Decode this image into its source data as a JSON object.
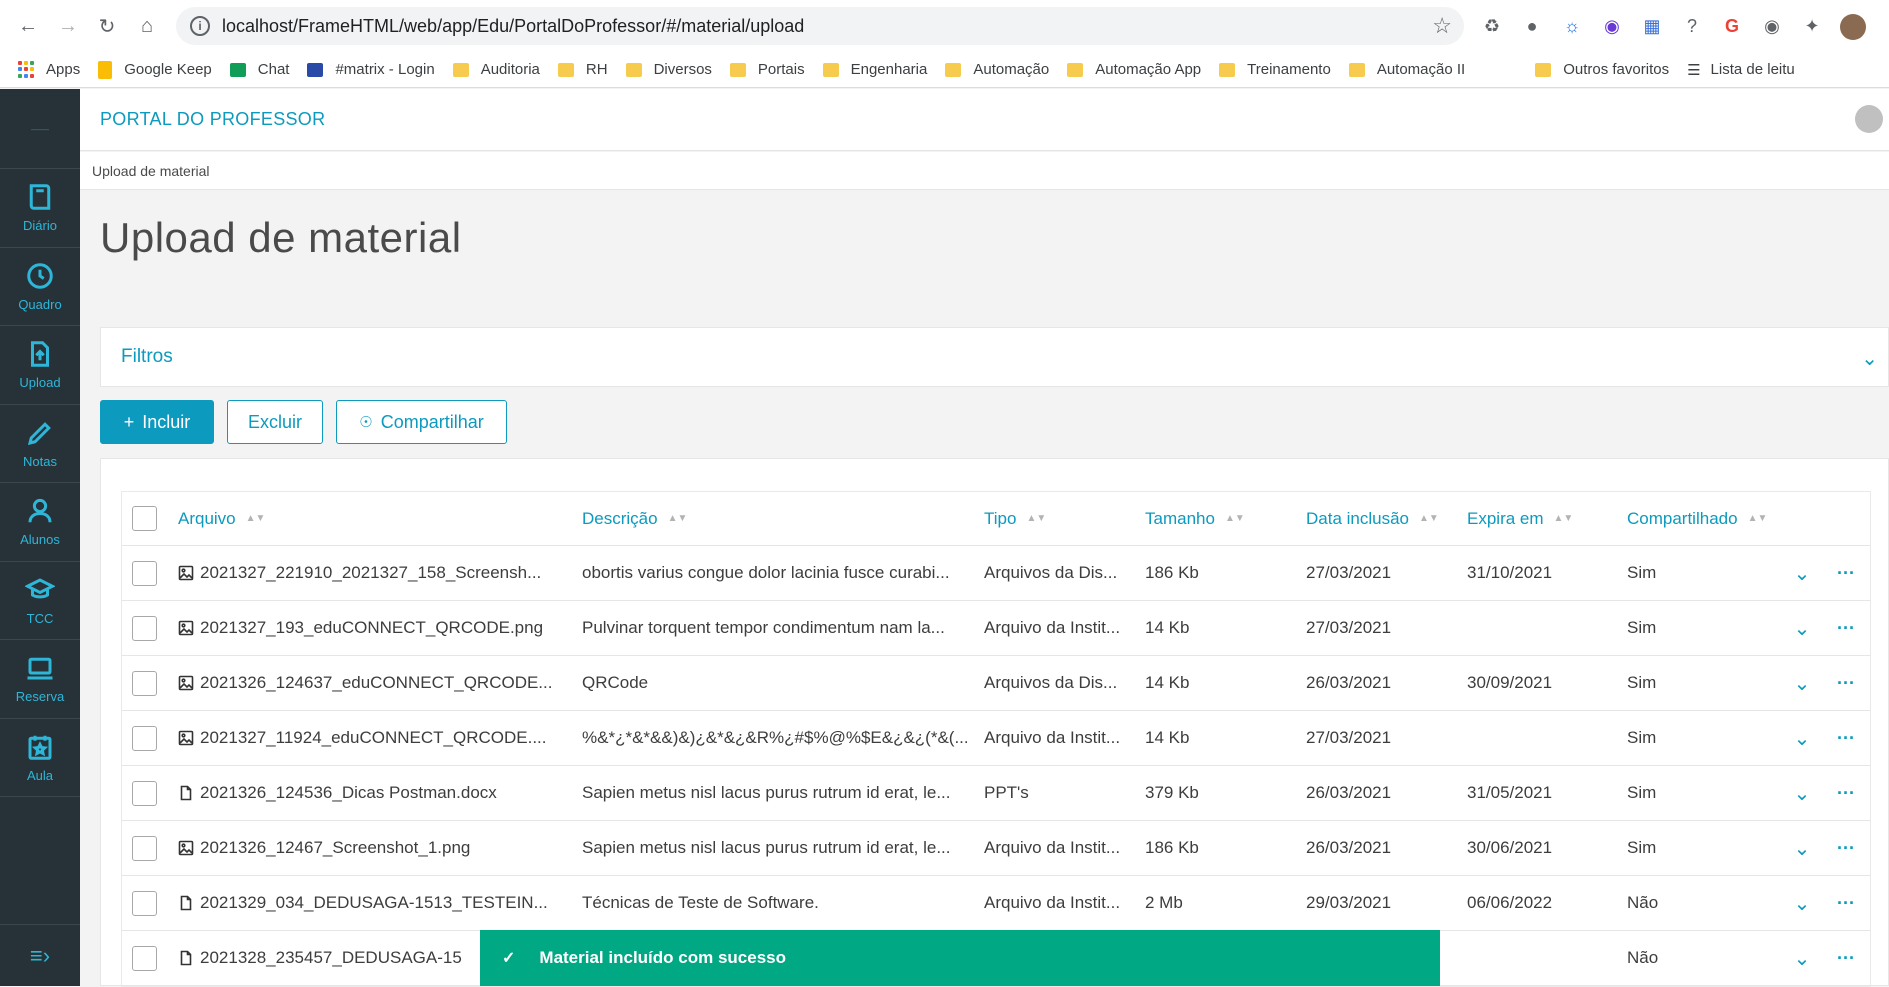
{
  "browser": {
    "url": "localhost/FrameHTML/web/app/Edu/PortalDoProfessor/#/material/upload",
    "bookmarks": [
      "Apps",
      "Google Keep",
      "Chat",
      "#matrix - Login",
      "Auditoria",
      "RH",
      "Diversos",
      "Portais",
      "Engenharia",
      "Automação",
      "Automação App",
      "Treinamento",
      "Automação II",
      "Outros favoritos",
      "Lista de leitu"
    ]
  },
  "sidebar": {
    "items": [
      {
        "label": "Diário",
        "icon": "book-icon"
      },
      {
        "label": "Quadro",
        "icon": "clock-icon"
      },
      {
        "label": "Upload",
        "icon": "upload-icon"
      },
      {
        "label": "Notas",
        "icon": "pencil-icon"
      },
      {
        "label": "Alunos",
        "icon": "user-icon"
      },
      {
        "label": "TCC",
        "icon": "graduation-cap-icon"
      },
      {
        "label": "Reserva",
        "icon": "laptop-icon"
      },
      {
        "label": "Aula",
        "icon": "calendar-star-icon"
      }
    ]
  },
  "header": {
    "title": "PORTAL DO PROFESSOR"
  },
  "breadcrumb": "Upload de material",
  "page": {
    "title": "Upload de material"
  },
  "filters": {
    "label": "Filtros"
  },
  "actions": {
    "include": "Incluir",
    "exclude": "Excluir",
    "share": "Compartilhar"
  },
  "table": {
    "columns": [
      "Arquivo",
      "Descrição",
      "Tipo",
      "Tamanho",
      "Data inclusão",
      "Expira em",
      "Compartilhado"
    ],
    "rows": [
      {
        "file": "2021327_221910_2021327_158_Screensh...",
        "icon": "image",
        "desc": "obortis varius congue dolor lacinia fusce curabi...",
        "tipo": "Arquivos da Dis...",
        "size": "186 Kb",
        "date": "27/03/2021",
        "exp": "31/10/2021",
        "shared": "Sim"
      },
      {
        "file": "2021327_193_eduCONNECT_QRCODE.png",
        "icon": "image",
        "desc": "Pulvinar torquent tempor condimentum nam la...",
        "tipo": "Arquivo da Instit...",
        "size": "14 Kb",
        "date": "27/03/2021",
        "exp": "",
        "shared": "Sim"
      },
      {
        "file": "2021326_124637_eduCONNECT_QRCODE...",
        "icon": "image",
        "desc": "QRCode",
        "tipo": "Arquivos da Dis...",
        "size": "14 Kb",
        "date": "26/03/2021",
        "exp": "30/09/2021",
        "shared": "Sim"
      },
      {
        "file": "2021327_11924_eduCONNECT_QRCODE....",
        "icon": "image",
        "desc": "%&*¿*&*&&)&)¿&*&¿&R%¿#$%@%$E&¿&¿(*&(...",
        "tipo": "Arquivo da Instit...",
        "size": "14 Kb",
        "date": "27/03/2021",
        "exp": "",
        "shared": "Sim"
      },
      {
        "file": "2021326_124536_Dicas Postman.docx",
        "icon": "doc",
        "desc": "Sapien metus nisl lacus purus rutrum id erat, le...",
        "tipo": "PPT's",
        "size": "379 Kb",
        "date": "26/03/2021",
        "exp": "31/05/2021",
        "shared": "Sim"
      },
      {
        "file": "2021326_12467_Screenshot_1.png",
        "icon": "image",
        "desc": "Sapien metus nisl lacus purus rutrum id erat, le...",
        "tipo": "Arquivo da Instit...",
        "size": "186 Kb",
        "date": "26/03/2021",
        "exp": "30/06/2021",
        "shared": "Sim"
      },
      {
        "file": "2021329_034_DEDUSAGA-1513_TESTEIN...",
        "icon": "doc",
        "desc": "Técnicas de Teste de Software.",
        "tipo": "Arquivo da Instit...",
        "size": "2 Mb",
        "date": "29/03/2021",
        "exp": "06/06/2022",
        "shared": "Não"
      },
      {
        "file": "2021328_235457_DEDUSAGA-15",
        "icon": "doc",
        "desc": "",
        "tipo": "",
        "size": "",
        "date": "",
        "exp": "",
        "shared": "Não"
      }
    ]
  },
  "toast": {
    "message": "Material incluído com sucesso"
  },
  "colors": {
    "accent": "#0c9abe",
    "sidebar": "#263238",
    "toast": "#00a884"
  }
}
